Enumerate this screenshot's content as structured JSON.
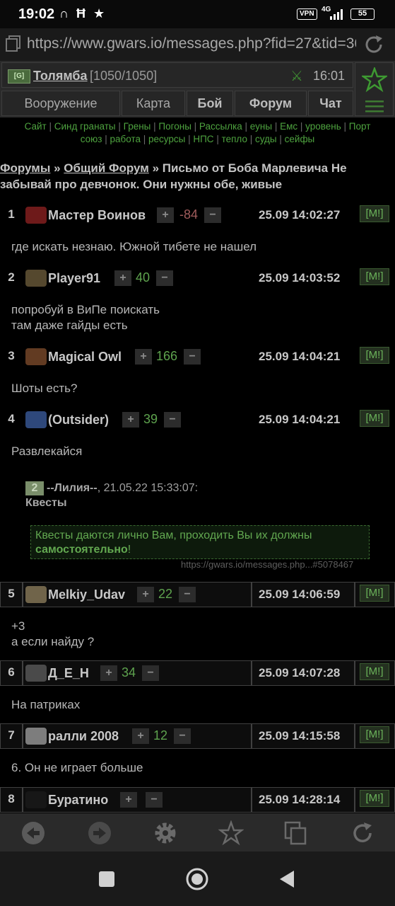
{
  "status": {
    "time": "19:02",
    "vpn": "VPN",
    "network": "4G",
    "battery": "55"
  },
  "browser": {
    "url": "https://www.gwars.io/messages.php?fid=27&tid=36"
  },
  "header": {
    "player_name": "Толямба",
    "hp": "[1050/1050]",
    "time": "16:01",
    "flag_text": "[G]",
    "nav": [
      "Вооружение",
      "Карта",
      "Бой",
      "Форум",
      "Чат"
    ]
  },
  "quick_links_line1": [
    "Сайт",
    "Синд гранаты",
    "Грены",
    "Погоны",
    "Рассылка",
    "еуны",
    "Емс",
    "уровень",
    "Порт"
  ],
  "quick_links_line2": [
    "союз",
    "работа",
    "ресурсы",
    "НПС",
    "тепло",
    "суды",
    "сейфы"
  ],
  "breadcrumb": {
    "forums": "Форумы",
    "sep1": " » ",
    "general": "Общий Форум",
    "sep2": " » ",
    "topic": "Письмо от Боба Марлевича Не забывай про девчонок. Они нужны обе, живые"
  },
  "posts": [
    {
      "num": "1",
      "author": "Мастер Воинов",
      "score": "-84",
      "date": "25.09 14:02:27",
      "text": [
        "где искать незнаю. Южной тибете не нашел"
      ]
    },
    {
      "num": "2",
      "author": "Player91",
      "score": "40",
      "date": "25.09 14:03:52",
      "text": [
        "попробуй в ВиПе поискать",
        "там даже гайды есть"
      ]
    },
    {
      "num": "3",
      "author": "Magical Owl",
      "score": "166",
      "date": "25.09 14:04:21",
      "text": [
        "Шоты есть?"
      ]
    },
    {
      "num": "4",
      "author": "(Outsider)",
      "score": "39",
      "date": "25.09 14:04:21",
      "text": [
        "Развлекайся"
      ]
    },
    {
      "num": "5",
      "author": "Melkiy_Udav",
      "score": "22",
      "date": "25.09 14:06:59",
      "text": [
        "+3",
        "а если найду ?"
      ]
    },
    {
      "num": "6",
      "author": "Д_Е_Н",
      "score": "34",
      "date": "25.09 14:07:28",
      "text": [
        "На патриках"
      ]
    },
    {
      "num": "7",
      "author": "ралли 2008",
      "score": "12",
      "date": "25.09 14:15:58",
      "text": [
        "6. Он не играет больше"
      ]
    },
    {
      "num": "8",
      "author": "Буратино",
      "score": "",
      "date": "25.09 14:28:14",
      "text": []
    }
  ],
  "vote": {
    "plus": "+",
    "minus": "−",
    "m": "[M!]"
  },
  "quote": {
    "num": "2",
    "author": "--Лилия--",
    "date": ", 21.05.22 15:33:07:",
    "title": "Квесты",
    "text_normal": "Квесты даются лично Вам, проходить Вы их должны",
    "text_bold": "самостоятельно",
    "text_end": "!",
    "source": "https://gwars.io/messages.php...#5078467"
  },
  "colors": {
    "accent_green": "#4ea33f",
    "background": "#000000",
    "panel": "#2b2b2b"
  }
}
